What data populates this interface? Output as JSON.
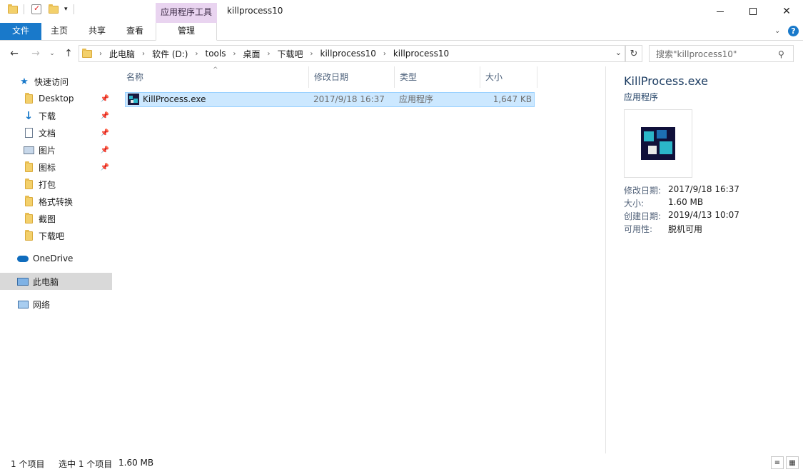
{
  "window": {
    "title": "killprocess10",
    "context_tab": "应用程序工具"
  },
  "ribbon": {
    "tabs": [
      "文件",
      "主页",
      "共享",
      "查看",
      "管理"
    ]
  },
  "address": {
    "crumbs": [
      "此电脑",
      "软件 (D:)",
      "tools",
      "桌面",
      "下载吧",
      "killprocess10",
      "killprocess10"
    ],
    "search_placeholder": "搜索\"killprocess10\""
  },
  "nav": {
    "quick_access": "快速访问",
    "items": [
      {
        "label": "Desktop",
        "icon": "folder-icon",
        "pinned": true
      },
      {
        "label": "下载",
        "icon": "download-arrow-icon",
        "pinned": true
      },
      {
        "label": "文档",
        "icon": "document-icon",
        "pinned": true
      },
      {
        "label": "图片",
        "icon": "picture-icon",
        "pinned": true
      },
      {
        "label": "图标",
        "icon": "folder-icon",
        "pinned": true
      },
      {
        "label": "打包",
        "icon": "folder-icon",
        "pinned": false
      },
      {
        "label": "格式转换",
        "icon": "folder-icon",
        "pinned": false
      },
      {
        "label": "截图",
        "icon": "folder-icon",
        "pinned": false
      },
      {
        "label": "下载吧",
        "icon": "folder-icon",
        "pinned": false
      }
    ],
    "onedrive": "OneDrive",
    "this_pc": "此电脑",
    "network": "网络"
  },
  "list": {
    "columns": [
      "名称",
      "修改日期",
      "类型",
      "大小"
    ],
    "rows": [
      {
        "name": "KillProcess.exe",
        "modified": "2017/9/18 16:37",
        "type": "应用程序",
        "size": "1,647 KB"
      }
    ]
  },
  "preview": {
    "title": "KillProcess.exe",
    "subtitle": "应用程序",
    "props": [
      {
        "label": "修改日期:",
        "value": "2017/9/18 16:37"
      },
      {
        "label": "大小:",
        "value": "1.60 MB"
      },
      {
        "label": "创建日期:",
        "value": "2019/4/13 10:07"
      },
      {
        "label": "可用性:",
        "value": "脱机可用"
      }
    ]
  },
  "status": {
    "count": "1 个项目",
    "selected": "选中 1 个项目",
    "size": "1.60 MB"
  },
  "colors": {
    "file_tab": "#1979ca",
    "context_tab": "#e9d4f0",
    "selection": "#cce8ff"
  }
}
